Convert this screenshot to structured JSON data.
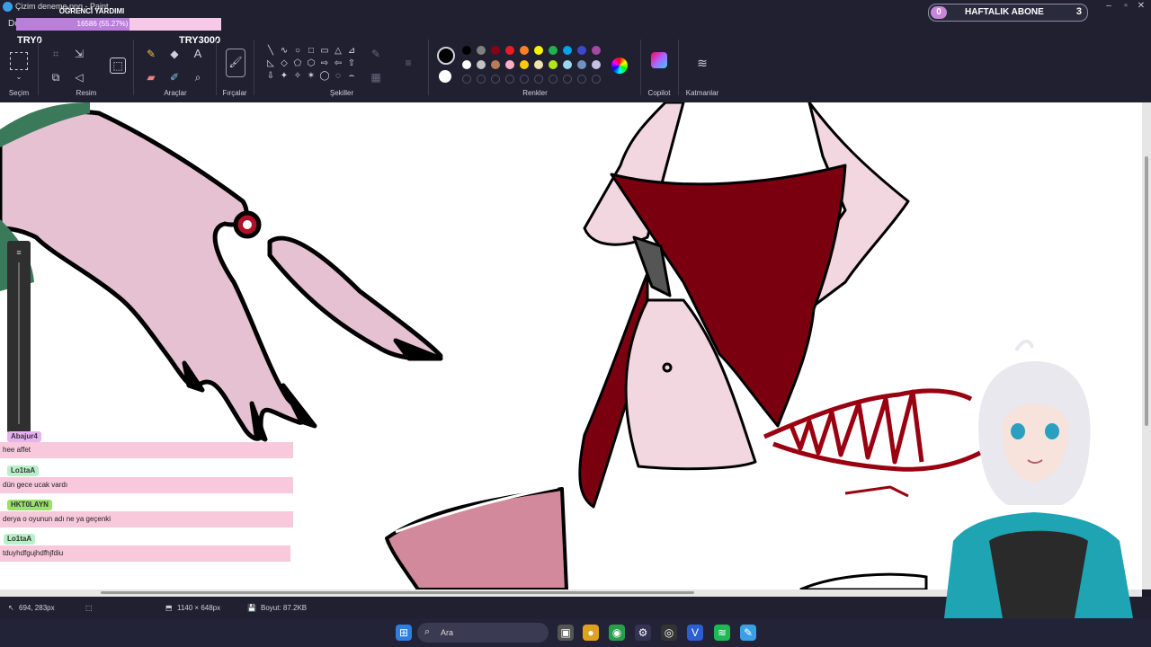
{
  "window": {
    "title": "Çizim deneme.png - Paint",
    "controls": [
      "–",
      "▫",
      "✕"
    ]
  },
  "menu": {
    "file_partial": "Do"
  },
  "stream_overlay": {
    "goal_title": "ÖĞRENCİ YARDIMI",
    "goal_progress_text": "16586 (55.27%)",
    "goal_fraction": 0.5527,
    "goal_min": "TRY0",
    "goal_max": "TRY3000",
    "sub_count_left": "0",
    "sub_label": "HAFTALIK ABONE",
    "sub_count_right": "3"
  },
  "ribbon": {
    "groups": {
      "selection": "Seçim",
      "image": "Resim",
      "tools": "Araçlar",
      "brushes": "Fırçalar",
      "shapes": "Şekiller",
      "colors": "Renkler",
      "copilot": "Copilot",
      "layers": "Katmanlar"
    },
    "text_tool": "A",
    "shape_glyphs": [
      "╲",
      "∿",
      "○",
      "□",
      "▭",
      "△",
      "⊿",
      "◺",
      "◇",
      "⬠",
      "⬡",
      "⇨",
      "⇦",
      "⇧",
      "⇩",
      "✦",
      "✧",
      "✶",
      "◯",
      "◌",
      "⌢"
    ],
    "palette_row1": [
      "#000000",
      "#7f7f7f",
      "#880015",
      "#ed1c24",
      "#ff7f27",
      "#fff200",
      "#22b14c",
      "#00a2e8",
      "#3f48cc",
      "#a349a4"
    ],
    "palette_row2": [
      "#ffffff",
      "#c3c3c3",
      "#b97a57",
      "#ffaec9",
      "#ffc90e",
      "#efe4b0",
      "#b5e61d",
      "#99d9ea",
      "#7092be",
      "#c8bfe7"
    ],
    "primary_color": "#000000",
    "secondary_color": "#ffffff"
  },
  "chat": {
    "messages": [
      {
        "user": "Abajur4",
        "user_color": "#e6b3f0",
        "text": "hee affet"
      },
      {
        "user": "Lo1taA",
        "user_color": "#b8f0c8",
        "text": "dün gece ucak vardı"
      },
      {
        "user": "HKT0LAYN",
        "user_color": "#9be06a",
        "text": "derya o oyunun adı ne ya geçenki"
      },
      {
        "user": "Lo1taA",
        "user_color": "#b8f0c8",
        "text": "tduyhdfgujhdfhjfdiu"
      }
    ]
  },
  "statusbar": {
    "cursor": "694, 283px",
    "selection_size": "",
    "canvas_size": "1140 × 648px",
    "file_size": "Boyut: 87.2KB"
  },
  "taskbar": {
    "search_placeholder": "Ara"
  }
}
